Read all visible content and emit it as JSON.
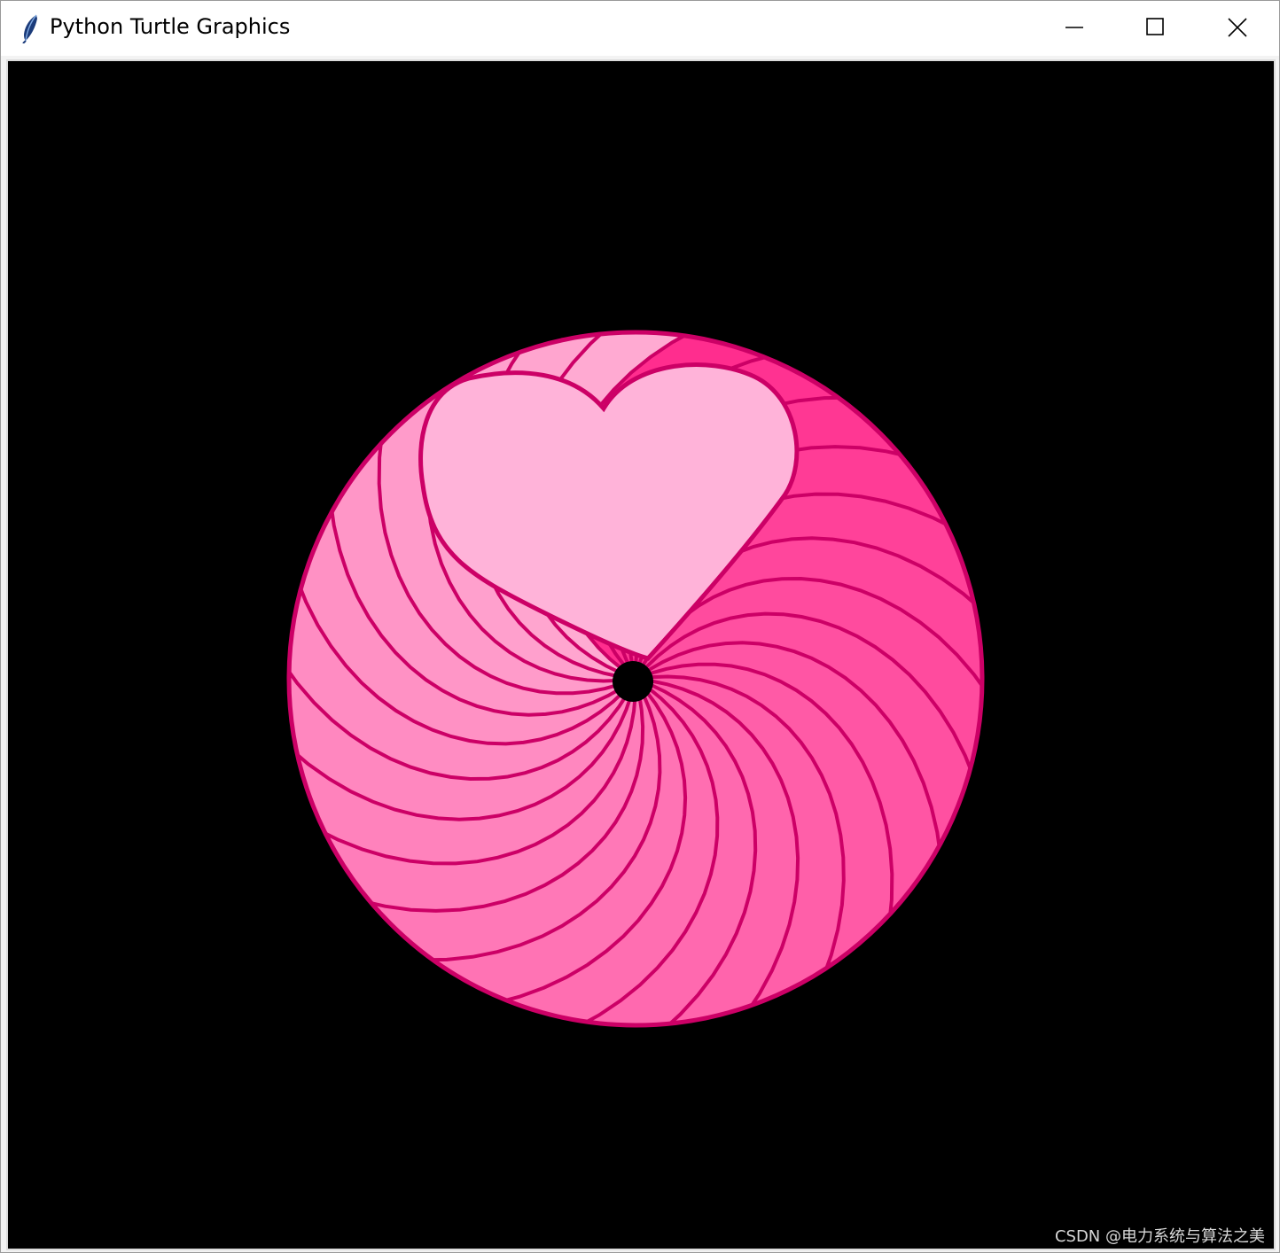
{
  "window": {
    "title": "Python Turtle Graphics",
    "icon": "feather-icon",
    "controls": {
      "minimize_icon": "minimize-icon",
      "maximize_icon": "maximize-icon",
      "close_icon": "close-icon"
    }
  },
  "canvas": {
    "background_color": "#000000",
    "drawing": {
      "pen_color": "#cc0066",
      "heart_fill_color": "#ffb3d9",
      "petal_gradient_light": "#ffaad2",
      "petal_gradient_dark": "#ff2d8e",
      "center_hole_color": "#000000"
    },
    "watermark": "CSDN @电力系统与算法之美"
  }
}
